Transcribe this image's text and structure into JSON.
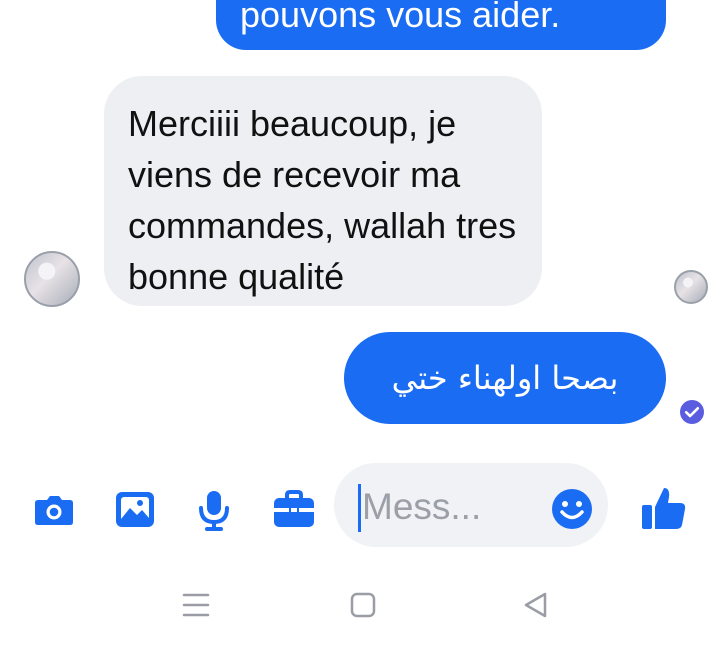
{
  "conversation": {
    "messages": [
      {
        "direction": "outgoing",
        "text": "pouvons vous aider."
      },
      {
        "direction": "incoming",
        "text": "Merciiii beaucoup, je viens de recevoir ma commandes, wallah tres bonne qualité"
      },
      {
        "direction": "outgoing",
        "text": "بصحا اولهناء ختي"
      }
    ]
  },
  "composer": {
    "placeholder": "Mess..."
  },
  "icons": {
    "camera": "camera-icon",
    "image": "image-icon",
    "microphone": "microphone-icon",
    "briefcase": "briefcase-icon",
    "emoji": "emoji-icon",
    "like": "thumbs-up-icon",
    "delivered": "check-circle-icon",
    "nav_recent": "recent-apps-icon",
    "nav_home": "home-icon",
    "nav_back": "back-icon"
  },
  "colors": {
    "accent": "#1a6cf2",
    "incoming_bubble": "#eeeff2",
    "delivered": "#5b5de0",
    "placeholder": "#9b9fa7",
    "nav": "#9a9da5"
  }
}
